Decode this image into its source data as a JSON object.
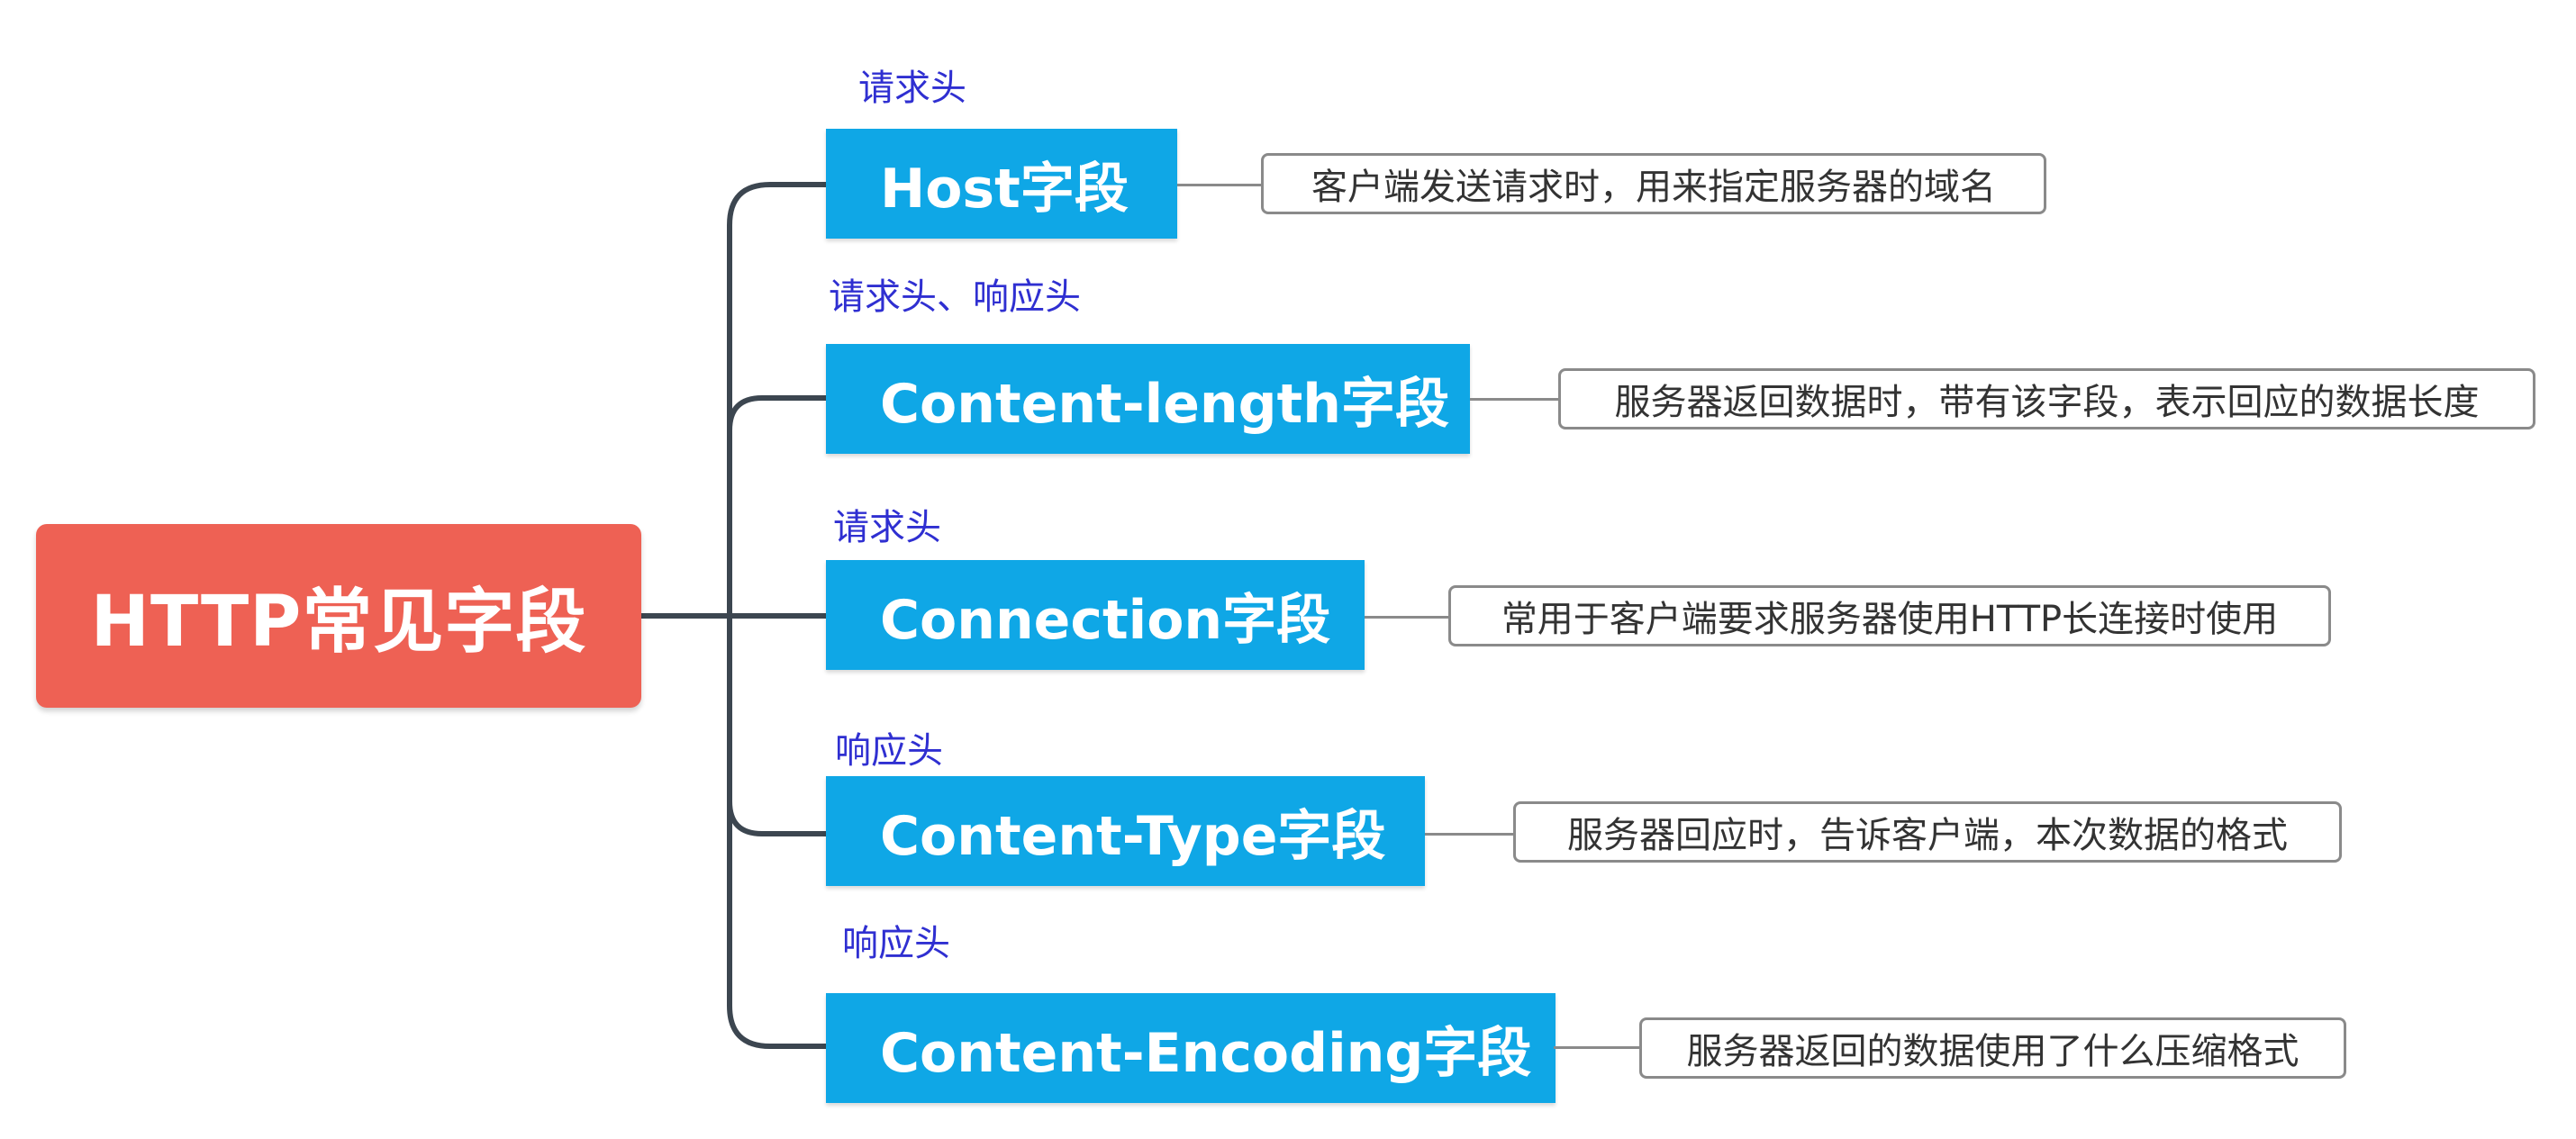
{
  "diagram": {
    "root": {
      "label": "HTTP常见字段",
      "color": "#ee6154"
    },
    "branch_color": "#0fa7e6",
    "note_color": "#2f2fd1",
    "branches": [
      {
        "label": "Host字段",
        "note": "请求头",
        "description": "客户端发送请求时，用来指定服务器的域名"
      },
      {
        "label": "Content-length字段",
        "note": "请求头、响应头",
        "description": "服务器返回数据时，带有该字段，表示回应的数据长度"
      },
      {
        "label": "Connection字段",
        "note": "请求头",
        "description": "常用于客户端要求服务器使用HTTP长连接时使用"
      },
      {
        "label": "Content-Type字段",
        "note": "响应头",
        "description": "服务器回应时，告诉客户端，本次数据的格式"
      },
      {
        "label": "Content-Encoding字段",
        "note": "响应头",
        "description": "服务器返回的数据使用了什么压缩格式"
      }
    ]
  }
}
